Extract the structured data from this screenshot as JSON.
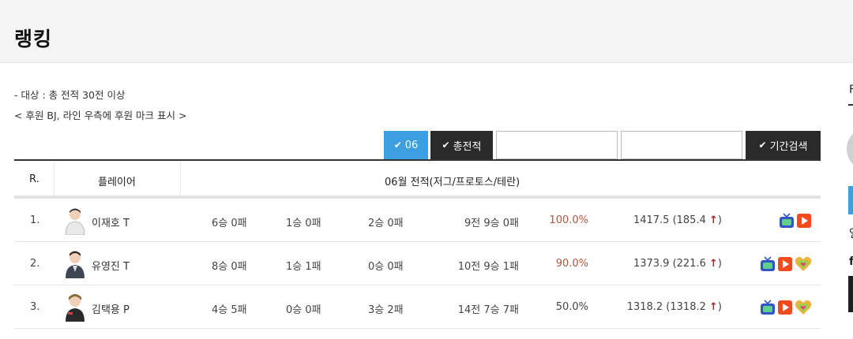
{
  "page": {
    "title": "랭킹"
  },
  "notes": {
    "line1": "- 대상 : 총 전적 30전 이상",
    "line2": "< 후원 BJ, 라인 우측에 후원 마크 표시 >"
  },
  "filters": {
    "month_label": "06",
    "total_label": "총전적",
    "start_date": "",
    "end_date": "",
    "search_label": "기간검색"
  },
  "table": {
    "headers": {
      "rank": "R.",
      "player": "플레이어",
      "record": "06월 전적(저그/프로토스/테란)"
    },
    "rows": [
      {
        "rank": "1.",
        "name": "이재호 T",
        "zerg": "6승 0패",
        "protoss": "1승 0패",
        "terran": "2승 0패",
        "total": "9전 9승 0패",
        "rate": "100.0%",
        "elo": "1417.5 (185.4",
        "elo_arrow": "↑",
        "elo_close": ")",
        "rate_color": "#b5563a",
        "icons": [
          "tv-icon",
          "play-icon"
        ]
      },
      {
        "rank": "2.",
        "name": "유영진 T",
        "zerg": "8승 0패",
        "protoss": "1승 1패",
        "terran": "0승 0패",
        "total": "10전 9승 1패",
        "rate": "90.0%",
        "elo": "1373.9 (221.6",
        "elo_arrow": "↑",
        "elo_close": ")",
        "rate_color": "#b5563a",
        "icons": [
          "tv-icon",
          "play-icon",
          "heart-icon"
        ]
      },
      {
        "rank": "3.",
        "name": "김택용 P",
        "zerg": "4승 5패",
        "protoss": "0승 0패",
        "terran": "3승 2패",
        "total": "14전 7승 7패",
        "rate": "50.0%",
        "elo": "1318.2 (1318.2",
        "elo_arrow": "↑",
        "elo_close": ")",
        "rate_color": "#444444",
        "icons": [
          "tv-icon",
          "play-icon",
          "heart-icon"
        ]
      }
    ]
  },
  "sidebar": {
    "t1": "F",
    "t2": "일",
    "t3": "f"
  },
  "colors": {
    "accent": "#3d9ee0",
    "dark_button": "#2a2a2a",
    "up_arrow": "#b5202a"
  }
}
